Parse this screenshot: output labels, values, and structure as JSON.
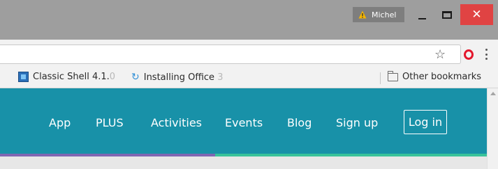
{
  "window": {
    "profile_name": "Michel",
    "close_glyph": "✕",
    "icons": [
      "warning-icon",
      "minimize-icon",
      "maximize-icon",
      "close-icon"
    ]
  },
  "toolbar": {
    "address_value": "",
    "star_glyph": "☆",
    "icons": [
      "star-icon",
      "opera-icon",
      "more-menu-icon"
    ]
  },
  "bookmarks": {
    "items": [
      {
        "label": "Classic Shell 4.1.",
        "faded": "0",
        "icon": "classic-shell-icon"
      },
      {
        "label": "Installing Office ",
        "faded": "3",
        "icon": "sync-icon"
      }
    ],
    "other_label": "Other bookmarks",
    "sync_glyph": "↻"
  },
  "site_nav": {
    "links": [
      "App",
      "PLUS",
      "Activities",
      "Events",
      "Blog",
      "Sign up"
    ],
    "login_label": "Log in"
  },
  "colors": {
    "header_bg": "#1891a8",
    "close_button": "#e04343",
    "accent_purple": "#7f67b3",
    "accent_green": "#39c39a"
  }
}
